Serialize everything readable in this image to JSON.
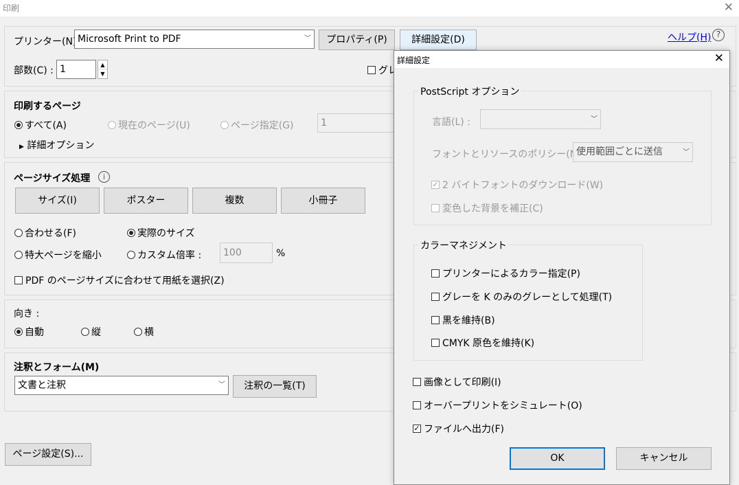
{
  "window": {
    "title": "印刷",
    "close": "✕"
  },
  "printer": {
    "label": "プリンター(N) :",
    "value": "Microsoft Print to PDF",
    "properties_button": "プロパティ(P)",
    "advanced_button": "詳細設定(D)",
    "help_link": "ヘルプ(H)",
    "help_icon": "?"
  },
  "copies": {
    "label": "部数(C) :",
    "value": "1",
    "grayscale_partial": "グレ"
  },
  "pages": {
    "title": "印刷するページ",
    "all": "すべて(A)",
    "current": "現在のページ(U)",
    "range": "ページ指定(G)",
    "range_value": "1",
    "more_options": "詳細オプション"
  },
  "page_sizing": {
    "title": "ページサイズ処理",
    "info_icon": "i",
    "tabs": [
      "サイズ(I)",
      "ポスター",
      "複数",
      "小冊子"
    ],
    "fit": "合わせる(F)",
    "actual": "実際のサイズ",
    "shrink": "特大ページを縮小",
    "custom": "カスタム倍率 :",
    "custom_value": "100",
    "percent": "%",
    "pdf_paper": "PDF のページサイズに合わせて用紙を選択(Z)"
  },
  "orientation": {
    "title": "向き :",
    "auto": "自動",
    "portrait": "縦",
    "landscape": "横"
  },
  "comments": {
    "title": "注釈とフォーム(M)",
    "value": "文書と注釈",
    "summarize_button": "注釈の一覧(T)"
  },
  "page_setup_button": "ページ設定(S)...",
  "advanced": {
    "title": "詳細設定",
    "close": "✕",
    "postscript": {
      "legend": "PostScript オプション",
      "language_label": "言語(L) :",
      "language_value": "",
      "font_policy_label": "フォントとリソースのポリシー(N) :",
      "font_policy_value": "使用範囲ごとに送信",
      "download_2byte": "2 バイトフォントのダウンロード(W)",
      "correct_background": "変色した背景を補正(C)"
    },
    "color": {
      "legend": "カラーマネジメント",
      "printer_color": "プリンターによるカラー指定(P)",
      "gray_to_k": "グレーを K のみのグレーとして処理(T)",
      "keep_black": "黒を維持(B)",
      "keep_cmyk": "CMYK 原色を維持(K)"
    },
    "print_as_image": "画像として印刷(I)",
    "simulate_overprint": "オーバープリントをシミュレート(O)",
    "print_to_file": "ファイルへ出力(F)",
    "ok": "OK",
    "cancel": "キャンセル"
  }
}
